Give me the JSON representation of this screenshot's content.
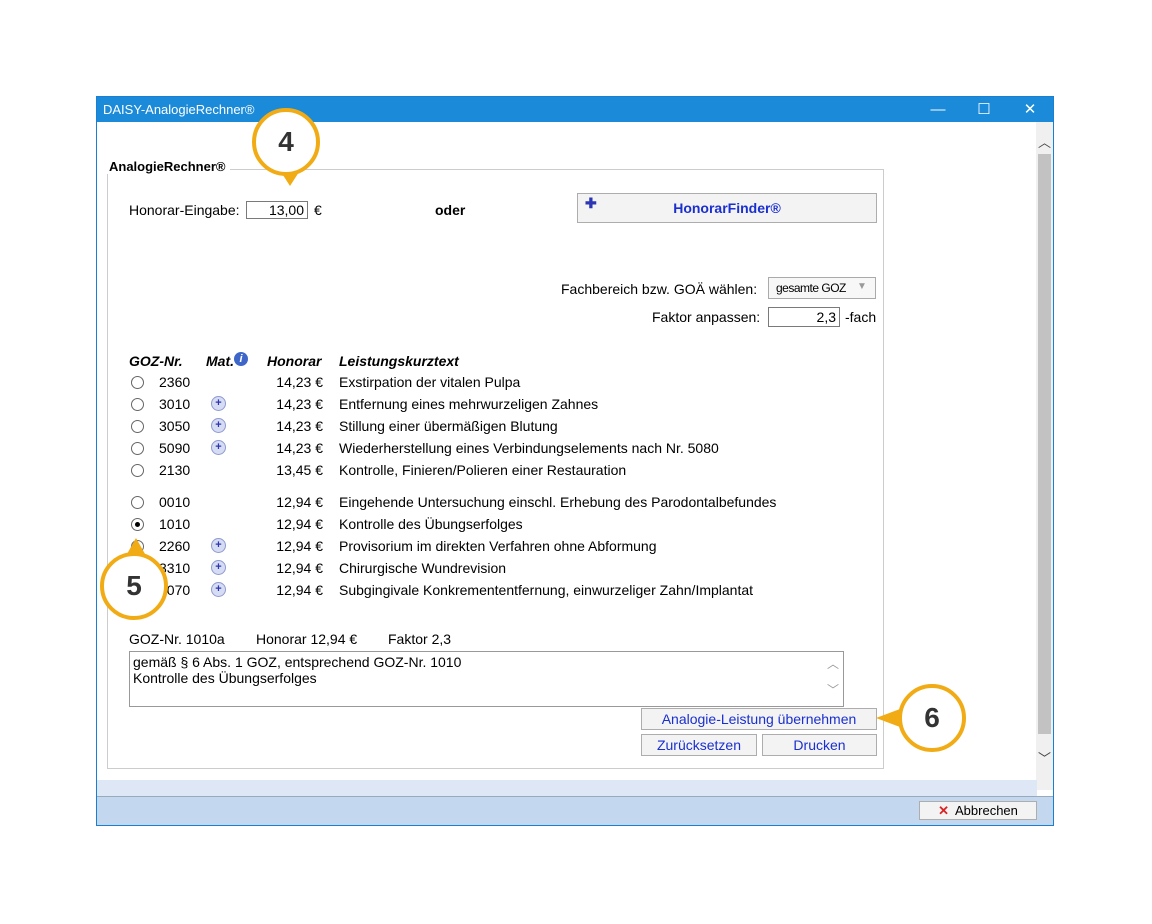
{
  "window": {
    "title": "DAISY-AnalogieRechner®",
    "minimize": "—",
    "maximize": "☐",
    "close": "✕"
  },
  "group_label": "AnalogieRechner®",
  "honorar": {
    "label": "Honorar-Eingabe:",
    "value": "13,00",
    "currency": "€",
    "oder": "oder",
    "finder_button": "HonorarFinder®"
  },
  "fachbereich": {
    "label": "Fachbereich bzw. GOÄ wählen:",
    "selected": "gesamte GOZ"
  },
  "faktor": {
    "label": "Faktor anpassen:",
    "value": "2,3",
    "suffix": "-fach"
  },
  "columns": {
    "goz": "GOZ-Nr.",
    "mat": "Mat.",
    "honorar": "Honorar",
    "text": "Leistungskurztext"
  },
  "rows": [
    {
      "code": "2360",
      "mat": false,
      "price": "14,23 €",
      "text": "Exstirpation der vitalen Pulpa",
      "selected": false
    },
    {
      "code": "3010",
      "mat": true,
      "price": "14,23 €",
      "text": "Entfernung eines mehrwurzeligen Zahnes",
      "selected": false
    },
    {
      "code": "3050",
      "mat": true,
      "price": "14,23 €",
      "text": "Stillung einer übermäßigen Blutung",
      "selected": false
    },
    {
      "code": "5090",
      "mat": true,
      "price": "14,23 €",
      "text": "Wiederherstellung eines Verbindungselements nach Nr. 5080",
      "selected": false
    },
    {
      "code": "2130",
      "mat": false,
      "price": "13,45 €",
      "text": "Kontrolle, Finieren/Polieren einer Restauration",
      "selected": false
    },
    {
      "code": "0010",
      "mat": false,
      "price": "12,94 €",
      "text": "Eingehende Untersuchung einschl. Erhebung des Parodontalbefundes",
      "selected": false
    },
    {
      "code": "1010",
      "mat": false,
      "price": "12,94 €",
      "text": "Kontrolle des Übungserfolges",
      "selected": true
    },
    {
      "code": "2260",
      "mat": true,
      "price": "12,94 €",
      "text": "Provisorium im direkten Verfahren ohne Abformung",
      "selected": false
    },
    {
      "code": "3310",
      "mat": true,
      "price": "12,94 €",
      "text": "Chirurgische Wundrevision",
      "selected": false
    },
    {
      "code": "4070",
      "mat": true,
      "price": "12,94 €",
      "text": "Subgingivale Konkremententfernung, einwurzeliger Zahn/Implantat",
      "selected": false
    }
  ],
  "summary": {
    "goz": "GOZ-Nr. 1010a",
    "honorar": "Honorar 12,94 €",
    "faktor": "Faktor 2,3",
    "line1": "gemäß § 6 Abs. 1 GOZ, entsprechend GOZ-Nr. 1010",
    "line2": "Kontrolle des Übungserfolges"
  },
  "buttons": {
    "uebernehmen": "Analogie-Leistung übernehmen",
    "zuruecksetzen": "Zurücksetzen",
    "drucken": "Drucken",
    "abbrechen": "Abbrechen"
  },
  "callouts": {
    "c4": "4",
    "c5": "5",
    "c6": "6"
  },
  "colors": {
    "titlebar": "#1a8ad9",
    "accent_link": "#1a2fcf",
    "callout_ring": "#f1ab14"
  }
}
